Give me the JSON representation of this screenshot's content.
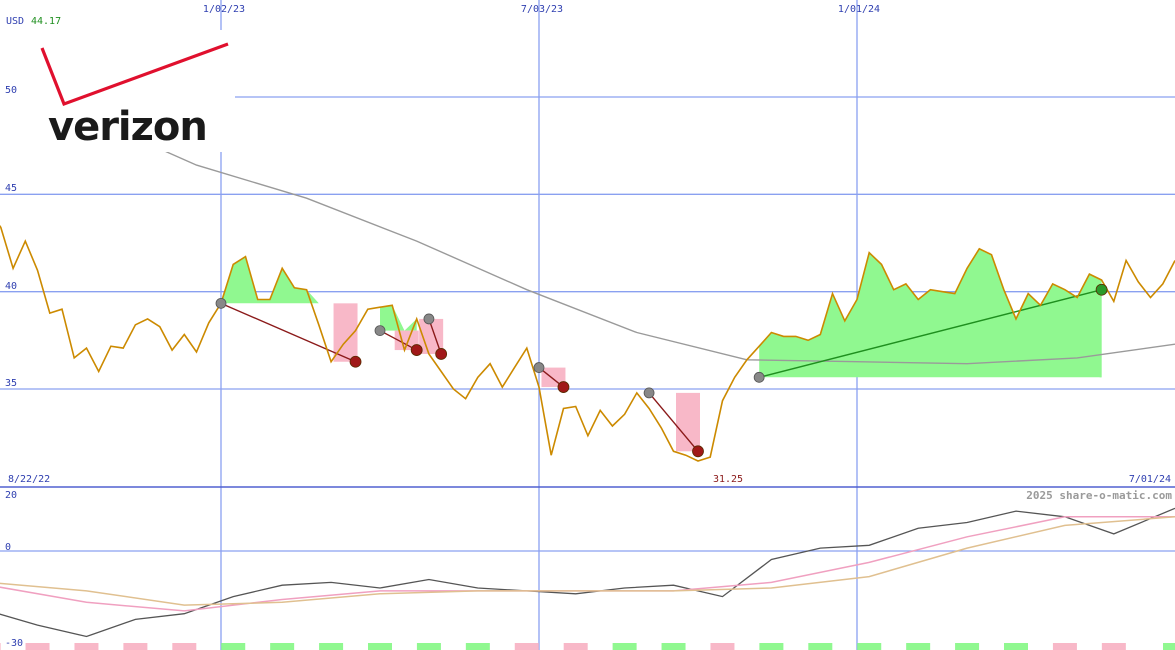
{
  "header": {
    "currency": "USD",
    "last_price": "44.17"
  },
  "brand": {
    "name": "verizon",
    "logo_text_color": "#1a1a1a",
    "logo_check_color": "#e0102e"
  },
  "watermark": "2025 share-o-matic.com",
  "colors": {
    "price": "#cc8a00",
    "sma": "#9a9a9a",
    "grid": "#8aa0f0",
    "gain_fill": "#90f890",
    "loss_fill": "#f8b8c8",
    "trend_down": "#8b1a1a",
    "trend_up": "#1f8f1f",
    "macd": "#555555",
    "signal_pink": "#f0a0c0",
    "signal_tan": "#e0c090",
    "vol_pos": "#90f890",
    "vol_neg": "#f8b8c8"
  },
  "chart_data": [
    {
      "type": "line",
      "title": "",
      "x_start_label": "8/22/22",
      "x_end_label": "7/01/24",
      "x_ticks": [
        "1/02/23",
        "7/03/23",
        "1/01/24"
      ],
      "y_ticks": [
        35,
        40,
        45,
        50
      ],
      "ylim": [
        30,
        55
      ],
      "min_label": "31.25",
      "grid": true,
      "series": [
        {
          "key": "price",
          "x": [
            "2022-08-22",
            "2022-08-29",
            "2022-09-05",
            "2022-09-12",
            "2022-09-19",
            "2022-09-26",
            "2022-10-03",
            "2022-10-10",
            "2022-10-17",
            "2022-10-24",
            "2022-10-31",
            "2022-11-07",
            "2022-11-14",
            "2022-11-21",
            "2022-11-28",
            "2022-12-05",
            "2022-12-12",
            "2022-12-19",
            "2022-12-26",
            "2023-01-02",
            "2023-01-09",
            "2023-01-16",
            "2023-01-23",
            "2023-01-30",
            "2023-02-06",
            "2023-02-13",
            "2023-02-20",
            "2023-02-27",
            "2023-03-06",
            "2023-03-13",
            "2023-03-20",
            "2023-03-27",
            "2023-04-03",
            "2023-04-10",
            "2023-04-17",
            "2023-04-24",
            "2023-05-01",
            "2023-05-08",
            "2023-05-15",
            "2023-05-22",
            "2023-05-29",
            "2023-06-05",
            "2023-06-12",
            "2023-06-19",
            "2023-06-26",
            "2023-07-03",
            "2023-07-10",
            "2023-07-17",
            "2023-07-24",
            "2023-07-31",
            "2023-08-07",
            "2023-08-14",
            "2023-08-21",
            "2023-08-28",
            "2023-09-04",
            "2023-09-11",
            "2023-09-18",
            "2023-09-25",
            "2023-10-02",
            "2023-10-09",
            "2023-10-16",
            "2023-10-23",
            "2023-10-30",
            "2023-11-06",
            "2023-11-13",
            "2023-11-20",
            "2023-11-27",
            "2023-12-04",
            "2023-12-11",
            "2023-12-18",
            "2023-12-25",
            "2024-01-01",
            "2024-01-08",
            "2024-01-15",
            "2024-01-22",
            "2024-01-29",
            "2024-02-05",
            "2024-02-12",
            "2024-02-19",
            "2024-02-26",
            "2024-03-04",
            "2024-03-11",
            "2024-03-18",
            "2024-03-25",
            "2024-04-01",
            "2024-04-08",
            "2024-04-15",
            "2024-04-22",
            "2024-04-29",
            "2024-05-06",
            "2024-05-13",
            "2024-05-20",
            "2024-05-27",
            "2024-06-03",
            "2024-06-10",
            "2024-06-17",
            "2024-06-24",
            "2024-07-01"
          ],
          "values": [
            44.2,
            43.3,
            41.2,
            42.6,
            41.1,
            38.9,
            39.1,
            36.6,
            37.1,
            35.9,
            37.2,
            37.1,
            38.3,
            38.6,
            38.2,
            37.0,
            37.8,
            36.9,
            38.4,
            39.4,
            41.4,
            41.8,
            39.6,
            39.6,
            41.2,
            40.2,
            40.1,
            38.3,
            36.4,
            37.3,
            38.0,
            39.1,
            39.2,
            39.3,
            37.0,
            38.6,
            36.8,
            35.9,
            35.0,
            34.5,
            35.6,
            36.3,
            35.1,
            36.1,
            37.1,
            35.1,
            31.6,
            34.0,
            34.1,
            32.6,
            33.9,
            33.1,
            33.7,
            34.8,
            34.0,
            33.0,
            31.8,
            31.6,
            31.3,
            31.5,
            34.4,
            35.6,
            36.5,
            37.2,
            37.9,
            37.7,
            37.7,
            37.5,
            37.8,
            39.9,
            38.5,
            39.6,
            42.0,
            41.4,
            40.1,
            40.4,
            39.6,
            40.1,
            40.0,
            39.9,
            41.2,
            42.2,
            41.9,
            40.1,
            38.6,
            39.9,
            39.3,
            40.4,
            40.1,
            39.7,
            40.9,
            40.6,
            39.5,
            41.6,
            40.5,
            39.7,
            40.4,
            41.6
          ]
        },
        {
          "key": "sma",
          "x": [
            "2022-08-22",
            "2022-10-17",
            "2022-12-19",
            "2023-02-20",
            "2023-04-24",
            "2023-06-26",
            "2023-08-28",
            "2023-10-30",
            "2024-01-01",
            "2024-03-04",
            "2024-05-06",
            "2024-07-01"
          ],
          "values": [
            51.3,
            49.0,
            46.5,
            44.8,
            42.6,
            40.1,
            37.9,
            36.5,
            36.4,
            36.3,
            36.6,
            37.3
          ]
        }
      ],
      "trend_segments": [
        {
          "from": [
            "2023-01-02",
            39.4
          ],
          "to": [
            "2023-03-20",
            36.4
          ],
          "direction": "down"
        },
        {
          "from": [
            "2023-04-03",
            38.0
          ],
          "to": [
            "2023-04-24",
            37.0
          ],
          "direction": "down"
        },
        {
          "from": [
            "2023-05-01",
            38.6
          ],
          "to": [
            "2023-05-08",
            36.8
          ],
          "direction": "down"
        },
        {
          "from": [
            "2023-07-03",
            36.1
          ],
          "to": [
            "2023-07-17",
            35.1
          ],
          "direction": "down"
        },
        {
          "from": [
            "2023-09-04",
            34.8
          ],
          "to": [
            "2023-10-02",
            31.8
          ],
          "direction": "down"
        },
        {
          "from": [
            "2023-11-06",
            35.6
          ],
          "to": [
            "2024-05-20",
            40.1
          ],
          "direction": "up"
        }
      ]
    },
    {
      "type": "line",
      "title": "",
      "y_ticks": [
        -30,
        0,
        20
      ],
      "ylim": [
        -30,
        25
      ],
      "grid": true,
      "series": [
        {
          "key": "macd",
          "x": [
            "2022-08-22",
            "2022-09-19",
            "2022-10-17",
            "2022-11-14",
            "2022-12-12",
            "2023-01-09",
            "2023-02-06",
            "2023-03-06",
            "2023-04-03",
            "2023-05-01",
            "2023-05-29",
            "2023-06-26",
            "2023-07-24",
            "2023-08-21",
            "2023-09-18",
            "2023-10-16",
            "2023-11-13",
            "2023-12-11",
            "2024-01-08",
            "2024-02-05",
            "2024-03-04",
            "2024-04-01",
            "2024-04-29",
            "2024-05-27",
            "2024-07-01"
          ],
          "values": [
            -21,
            -26,
            -30,
            -24,
            -22,
            -16,
            -12,
            -11,
            -13,
            -10,
            -13,
            -14,
            -15,
            -13,
            -12,
            -16,
            -3,
            1,
            2,
            8,
            10,
            14,
            12,
            6,
            15
          ]
        },
        {
          "key": "signal_pink",
          "x": [
            "2022-08-22",
            "2022-10-17",
            "2022-12-12",
            "2023-02-06",
            "2023-04-03",
            "2023-05-29",
            "2023-07-24",
            "2023-09-18",
            "2023-11-13",
            "2024-01-08",
            "2024-03-04",
            "2024-04-29",
            "2024-07-01"
          ],
          "values": [
            -12,
            -18,
            -21,
            -17,
            -14,
            -14,
            -14,
            -14,
            -11,
            -4,
            5,
            12,
            12
          ]
        },
        {
          "key": "signal_tan",
          "x": [
            "2022-08-22",
            "2022-10-17",
            "2022-12-12",
            "2023-02-06",
            "2023-04-03",
            "2023-05-29",
            "2023-07-24",
            "2023-09-18",
            "2023-11-13",
            "2024-01-08",
            "2024-03-04",
            "2024-04-29",
            "2024-07-01"
          ],
          "values": [
            -11,
            -14,
            -19,
            -18,
            -15,
            -14,
            -14,
            -14,
            -13,
            -9,
            1,
            9,
            12
          ]
        }
      ]
    }
  ]
}
